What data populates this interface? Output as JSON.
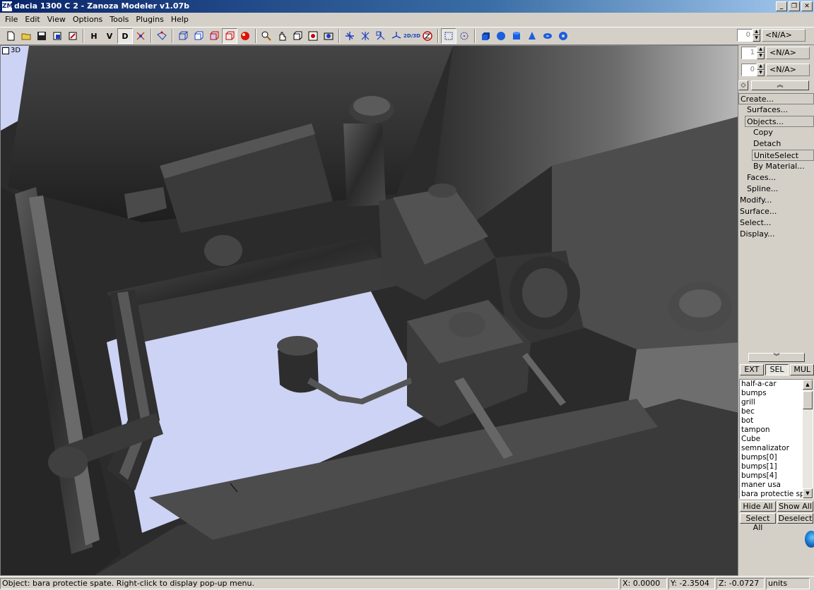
{
  "window": {
    "title": "dacia 1300 C 2 - Zanoza Modeler v1.07b",
    "app_icon": "ZM"
  },
  "menu": [
    "File",
    "Edit",
    "View",
    "Options",
    "Tools",
    "Plugins",
    "Help"
  ],
  "toolbar": {
    "letters": {
      "h": "H",
      "v": "V",
      "d": "D"
    },
    "text_buttons": {
      "twod_threed": "2D/3D"
    }
  },
  "spinners": [
    {
      "value": "0",
      "label": "<N/A>"
    },
    {
      "value": "1",
      "label": "<N/A>"
    },
    {
      "value": "0",
      "label": "<N/A>"
    }
  ],
  "viewport": {
    "label": "3D"
  },
  "side_panel": {
    "tree": [
      {
        "label": "Create...",
        "level": 0,
        "boxed": true
      },
      {
        "label": "Surfaces...",
        "level": 1,
        "boxed": false
      },
      {
        "label": "Objects...",
        "level": 1,
        "boxed": true
      },
      {
        "label": "Copy",
        "level": 2,
        "boxed": false
      },
      {
        "label": "Detach",
        "level": 2,
        "boxed": false
      },
      {
        "label": "UniteSelect",
        "level": 2,
        "boxed": true
      },
      {
        "label": "By Material...",
        "level": 2,
        "boxed": false
      },
      {
        "label": "Faces...",
        "level": 1,
        "boxed": false
      },
      {
        "label": "Spline...",
        "level": 1,
        "boxed": false
      },
      {
        "label": "Modify...",
        "level": 0,
        "boxed": false
      },
      {
        "label": "Surface...",
        "level": 0,
        "boxed": false
      },
      {
        "label": "Select...",
        "level": 0,
        "boxed": false
      },
      {
        "label": "Display...",
        "level": 0,
        "boxed": false
      }
    ],
    "modes": [
      "EXT",
      "SEL",
      "MUL"
    ],
    "active_mode": "SEL",
    "objects": [
      "half-a-car",
      "bumps",
      "grill",
      "bec",
      "bot",
      "tampon",
      "Cube",
      "semnalizator",
      "bumps[0]",
      "bumps[1]",
      "bumps[4]",
      "maner usa",
      "bara protectie spate"
    ],
    "buttons": {
      "hide_all": "Hide All",
      "show_all": "Show All",
      "select_all": "Select All",
      "deselect": "Deselect"
    }
  },
  "status": {
    "message": "Object: bara protectie spate. Right-click to display pop-up menu.",
    "x": "X: 0.0000",
    "y": "Y: -2.3504",
    "z": "Z: -0.0727",
    "units": "units"
  }
}
